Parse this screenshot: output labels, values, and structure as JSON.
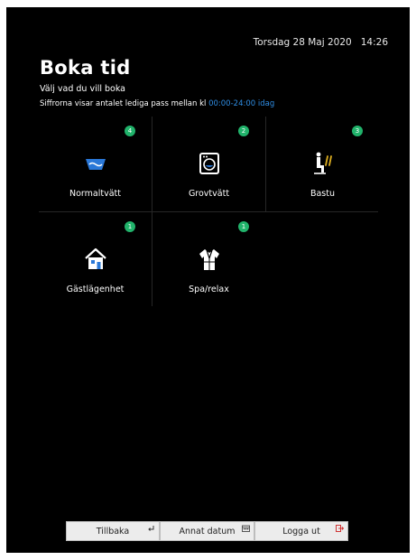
{
  "header": {
    "date": "Torsdag 28 Maj 2020",
    "time": "14:26"
  },
  "main": {
    "title": "Boka tid",
    "subtitle": "Välj vad du vill boka",
    "info_text": "Siffrorna visar antalet lediga pass mellan kl",
    "info_range": "00:00-24:00 idag"
  },
  "services": [
    {
      "label": "Normaltvätt",
      "available": "4",
      "icon": "washing-basin-icon"
    },
    {
      "label": "Grovtvätt",
      "available": "2",
      "icon": "washing-machine-icon"
    },
    {
      "label": "Bastu",
      "available": "3",
      "icon": "sauna-icon"
    },
    {
      "label": "Gästlägenhet",
      "available": "1",
      "icon": "guest-house-icon"
    },
    {
      "label": "Spa/relax",
      "available": "1",
      "icon": "bathrobe-icon"
    }
  ],
  "footer": {
    "back_label": "Tillbaka",
    "other_date_label": "Annat datum",
    "logout_label": "Logga ut"
  },
  "colors": {
    "background": "#000000",
    "badge": "#21b36b",
    "accent": "#2f8de4",
    "icon_blue": "#2a78d8",
    "sauna_yellow": "#e0b020"
  }
}
